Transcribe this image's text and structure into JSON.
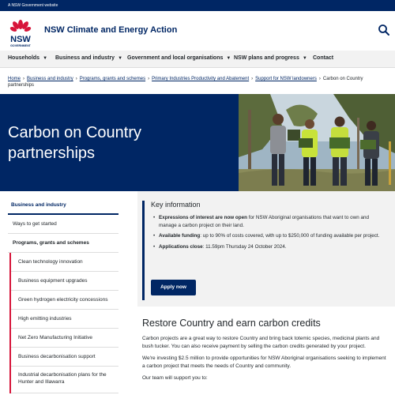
{
  "masthead": {
    "text": "A NSW Government website"
  },
  "header": {
    "logo_text": "NSW",
    "logo_subtext": "GOVERNMENT",
    "site_name": "NSW Climate and Energy Action",
    "search_icon": "search-icon"
  },
  "nav": {
    "items": [
      {
        "label": "Households",
        "has_dropdown": true
      },
      {
        "label": "Business and industry",
        "has_dropdown": true
      },
      {
        "label": "Government and local organisations",
        "has_dropdown": true
      },
      {
        "label": "NSW plans and progress",
        "has_dropdown": true
      },
      {
        "label": "Contact",
        "has_dropdown": false
      }
    ]
  },
  "breadcrumb": {
    "items": [
      "Home",
      "Business and industry",
      "Programs, grants and schemes",
      "Primary Industries Productivity and Abatement",
      "Support for NSW landowners"
    ],
    "current": "Carbon on Country partnerships"
  },
  "hero": {
    "title": "Carbon on Country partnerships"
  },
  "sidenav": {
    "top": "Business and industry",
    "ways": "Ways to get started",
    "group": "Programs, grants and schemes",
    "items": [
      "Clean technology innovation",
      "Business equipment upgrades",
      "Green hydrogen electricity concessions",
      "High emitting industries",
      "Net Zero Manufacturing Initiative",
      "Business decarbonisation support",
      "Industrial decarbonisation plans for the Hunter and Illawarra"
    ]
  },
  "key_info": {
    "title": "Key information",
    "items": [
      {
        "bold": "Expressions of interest are now open",
        "text": " for NSW Aboriginal organisations that want to own and manage a carbon project on their land."
      },
      {
        "bold": "Available funding",
        "text": ": up to 90% of costs covered, with up to $250,000 of funding available per project."
      },
      {
        "bold": "Applications close",
        "text": ": 11.59pm Thursday 24 October 2024."
      }
    ],
    "button": "Apply now"
  },
  "content": {
    "heading": "Restore Country and earn carbon credits",
    "paragraphs": [
      "Carbon projects are a great way to restore Country and bring back totemic species, medicinal plants and bush tucker. You can also receive payment by selling the carbon credits generated by your project.",
      "We're investing $2.5 million to provide opportunities for NSW Aboriginal organisations seeking to implement a carbon project that meets the needs of Country and community.",
      "Our team will support you to:"
    ]
  },
  "colors": {
    "brand_navy": "#002664",
    "brand_red": "#d7153a",
    "panel_grey": "#f2f2f2"
  }
}
